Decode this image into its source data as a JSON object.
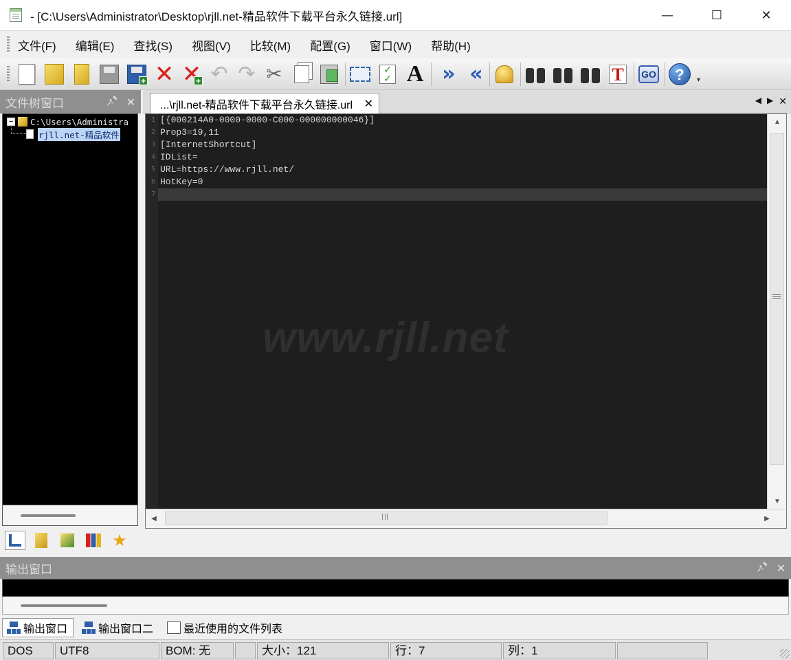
{
  "window": {
    "title": "- [C:\\Users\\Administrator\\Desktop\\rjll.net-精品软件下载平台永久链接.url]",
    "controls": {
      "minimize": "—",
      "maximize": "☐",
      "close": "✕"
    }
  },
  "menu": {
    "items": [
      "文件(F)",
      "编辑(E)",
      "查找(S)",
      "视图(V)",
      "比较(M)",
      "配置(G)",
      "窗口(W)",
      "帮助(H)"
    ]
  },
  "toolbar": {
    "icons": [
      "new-file-icon",
      "open-file-icon",
      "open-project-icon",
      "save-icon",
      "save-all-icon",
      "close-icon",
      "close-all-icon",
      "undo-icon",
      "redo-icon",
      "cut-icon",
      "copy-icon",
      "paste-icon",
      "select-icon",
      "compare-icon",
      "font-icon",
      "indent-icon",
      "outdent-icon",
      "bookmark-icon",
      "find-icon",
      "find-prev-icon",
      "find-next-icon",
      "replace-icon",
      "goto-icon",
      "help-icon"
    ],
    "labels": {
      "font": "A",
      "goto": "GO",
      "help": "?",
      "more": "▾"
    }
  },
  "file_tree": {
    "title": "文件树窗口",
    "pin": "📌",
    "close": "✕",
    "root": {
      "expander": "−",
      "label": "C:\\Users\\Administra"
    },
    "child": {
      "label": "rjll.net-精品软件"
    }
  },
  "editor": {
    "tab_label": "...\\rjll.net-精品软件下载平台永久链接.url",
    "tab_close": "✕",
    "tab_nav": {
      "prev": "◀",
      "next": "▶",
      "close": "✕"
    },
    "lines": [
      "[{000214A0-0000-0000-C000-000000000046}]",
      "Prop3=19,11",
      "[InternetShortcut]",
      "IDList=",
      "URL=https://www.rjll.net/",
      "HotKey=0",
      ""
    ],
    "line_numbers": [
      "1",
      "2",
      "3",
      "4",
      "5",
      "6",
      "7"
    ],
    "current_line": 7,
    "watermark": "www.rjll.net",
    "scroll": {
      "up": "▲",
      "down": "▼",
      "left": "◀",
      "right": "▶"
    }
  },
  "output": {
    "title": "输出窗口",
    "pin": "📌",
    "close": "✕",
    "tabs": [
      "输出窗口",
      "输出窗口二",
      "最近使用的文件列表"
    ]
  },
  "status": {
    "line_ending": "DOS",
    "encoding": "UTF8",
    "bom": "BOM: 无",
    "size": "大小：121",
    "row": "行：7",
    "col": "列：1"
  }
}
